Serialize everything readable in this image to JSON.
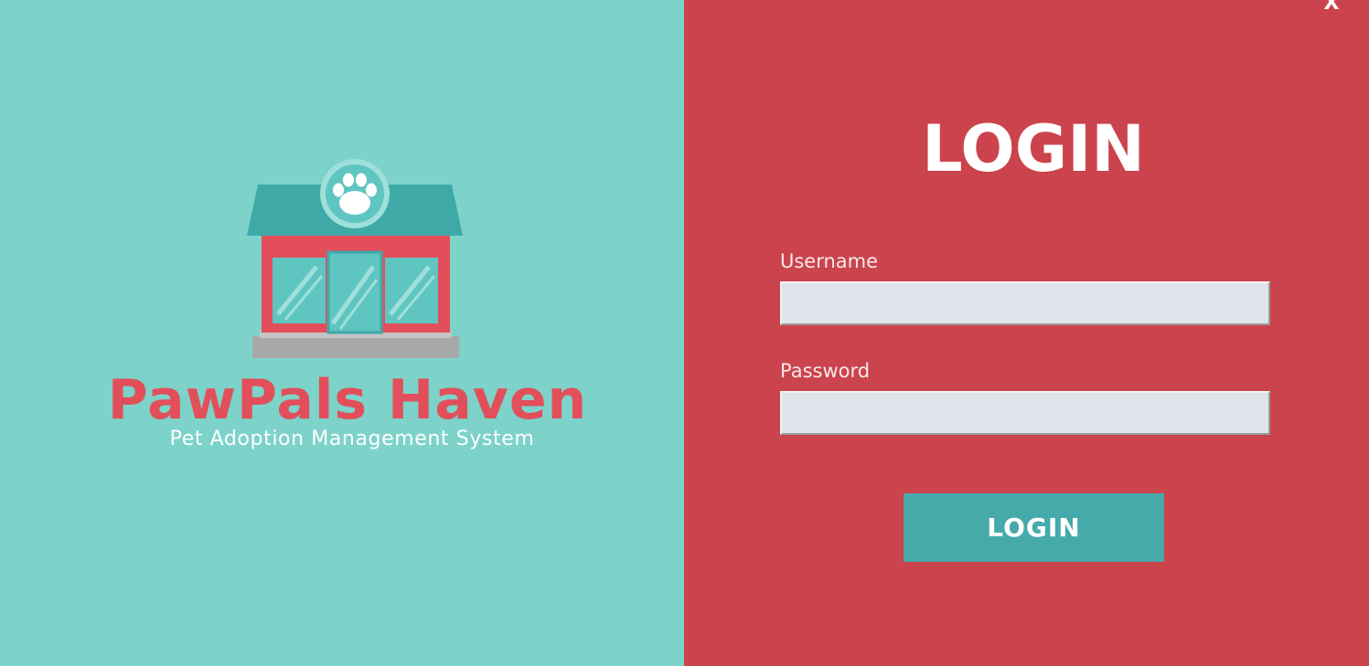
{
  "brand": {
    "name": "PawPals Haven",
    "tagline": "Pet Adoption Management System",
    "logo_icon": "pet-store-icon"
  },
  "window": {
    "close_label": "X"
  },
  "login": {
    "heading": "LOGIN",
    "username_label": "Username",
    "username_value": "",
    "password_label": "Password",
    "password_value": "",
    "submit_label": "LOGIN"
  },
  "colors": {
    "left_panel_bg": "#7dd2c9",
    "right_panel_bg": "#cb434c",
    "brand_text": "#e24f5a",
    "button_bg": "#45aaa9",
    "input_bg": "#e0e4ea"
  }
}
